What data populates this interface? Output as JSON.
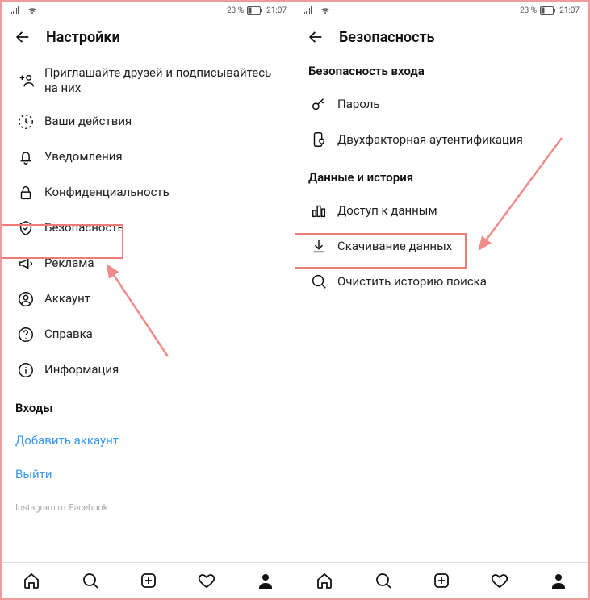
{
  "statusbar": {
    "percent": "23 %",
    "time": "21:07"
  },
  "left": {
    "title": "Настройки",
    "items": [
      {
        "label": "Приглашайте друзей и подписывайтесь на них",
        "icon": "add-person-icon"
      },
      {
        "label": "Ваши действия",
        "icon": "activity-icon"
      },
      {
        "label": "Уведомления",
        "icon": "bell-icon"
      },
      {
        "label": "Конфиденциальность",
        "icon": "lock-icon"
      },
      {
        "label": "Безопасность",
        "icon": "shield-check-icon"
      },
      {
        "label": "Реклама",
        "icon": "megaphone-icon"
      },
      {
        "label": "Аккаунт",
        "icon": "user-circle-icon"
      },
      {
        "label": "Справка",
        "icon": "help-icon"
      },
      {
        "label": "Информация",
        "icon": "info-icon"
      }
    ],
    "logins_header": "Входы",
    "add_account": "Добавить аккаунт",
    "logout": "Выйти",
    "footer": "Instagram от Facebook"
  },
  "right": {
    "title": "Безопасность",
    "section1": "Безопасность входа",
    "items1": [
      {
        "label": "Пароль",
        "icon": "key-icon"
      },
      {
        "label": "Двухфакторная аутентификация",
        "icon": "phone-shield-icon"
      }
    ],
    "section2": "Данные и история",
    "items2": [
      {
        "label": "Доступ к данным",
        "icon": "data-bars-icon"
      },
      {
        "label": "Скачивание данных",
        "icon": "download-icon"
      },
      {
        "label": "Очистить историю поиска",
        "icon": "search-icon"
      }
    ]
  }
}
